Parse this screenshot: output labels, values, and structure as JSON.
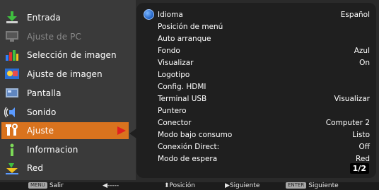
{
  "menu": {
    "items": [
      {
        "label": "Entrada",
        "icon": "input-download-icon",
        "state": "normal"
      },
      {
        "label": "Ajuste de PC",
        "icon": "pc-monitor-icon",
        "state": "disabled"
      },
      {
        "label": "Selección de imagen",
        "icon": "image-select-chart-icon",
        "state": "normal"
      },
      {
        "label": "Ajuste de imagen",
        "icon": "image-adjust-icon",
        "state": "normal"
      },
      {
        "label": "Pantalla",
        "icon": "screen-icon",
        "state": "normal"
      },
      {
        "label": "Sonido",
        "icon": "sound-icon",
        "state": "normal"
      },
      {
        "label": "Ajuste",
        "icon": "tools-icon",
        "state": "active"
      },
      {
        "label": "Informacion",
        "icon": "info-icon",
        "state": "normal"
      },
      {
        "label": "Red",
        "icon": "network-icon",
        "state": "normal"
      }
    ]
  },
  "options": [
    {
      "label": "Idioma",
      "value": "Español"
    },
    {
      "label": "Posición de menú",
      "value": ""
    },
    {
      "label": "Auto arranque",
      "value": ""
    },
    {
      "label": "Fondo",
      "value": "Azul"
    },
    {
      "label": "Visualizar",
      "value": "On"
    },
    {
      "label": "Logotipo",
      "value": ""
    },
    {
      "label": "Config. HDMI",
      "value": ""
    },
    {
      "label": "Terminal USB",
      "value": "Visualizar"
    },
    {
      "label": "Puntero",
      "value": ""
    },
    {
      "label": "Conector",
      "value": "Computer 2"
    },
    {
      "label": "Modo bajo consumo",
      "value": "Listo"
    },
    {
      "label": "Conexión Direct:",
      "value": "Off"
    },
    {
      "label": "Modo de espera",
      "value": "Red"
    }
  ],
  "page_indicator": "1/2",
  "bottom_bar": {
    "menu_key": "MENU",
    "salir": "Salir",
    "back": "◀-----",
    "posicion": "⬍Posición",
    "siguiente": "▶Siguiente",
    "enter_key": "ENTER",
    "siguiente2": "Siguiente"
  },
  "colors": {
    "active_bg": "#d9731e",
    "pointer": "#e02020",
    "panel_left": "#3a3a3a",
    "panel_right": "#1f1f1f"
  }
}
